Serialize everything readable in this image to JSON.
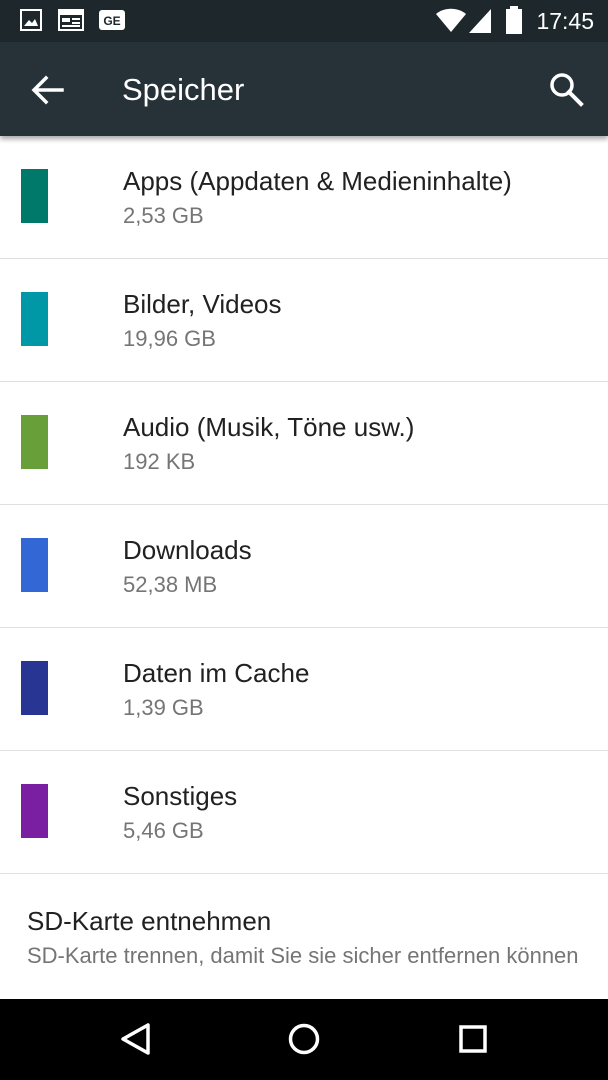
{
  "status_bar": {
    "time": "17:45",
    "icons": [
      "image-notification-icon",
      "calendar-notification-icon",
      "news-notification-icon",
      "wifi-icon",
      "signal-icon",
      "battery-icon"
    ]
  },
  "app_bar": {
    "title": "Speicher",
    "back_icon": "arrow-left-icon",
    "search_icon": "search-icon"
  },
  "storage_items": [
    {
      "label": "Apps (Appdaten & Medieninhalte)",
      "size": "2,53 GB",
      "color": "#00796b"
    },
    {
      "label": "Bilder, Videos",
      "size": "19,96 GB",
      "color": "#0097a7"
    },
    {
      "label": "Audio (Musik, Töne usw.)",
      "size": "192 KB",
      "color": "#689f38"
    },
    {
      "label": "Downloads",
      "size": "52,38 MB",
      "color": "#3367d6"
    },
    {
      "label": "Daten im Cache",
      "size": "1,39 GB",
      "color": "#283593"
    },
    {
      "label": "Sonstiges",
      "size": "5,46 GB",
      "color": "#7b1fa2"
    }
  ],
  "sd_card": {
    "label": "SD-Karte entnehmen",
    "description": "SD-Karte trennen, damit Sie sie sicher entfernen können"
  },
  "nav_bar": {
    "icons": [
      "back-triangle-icon",
      "home-circle-icon",
      "recents-square-icon"
    ]
  }
}
